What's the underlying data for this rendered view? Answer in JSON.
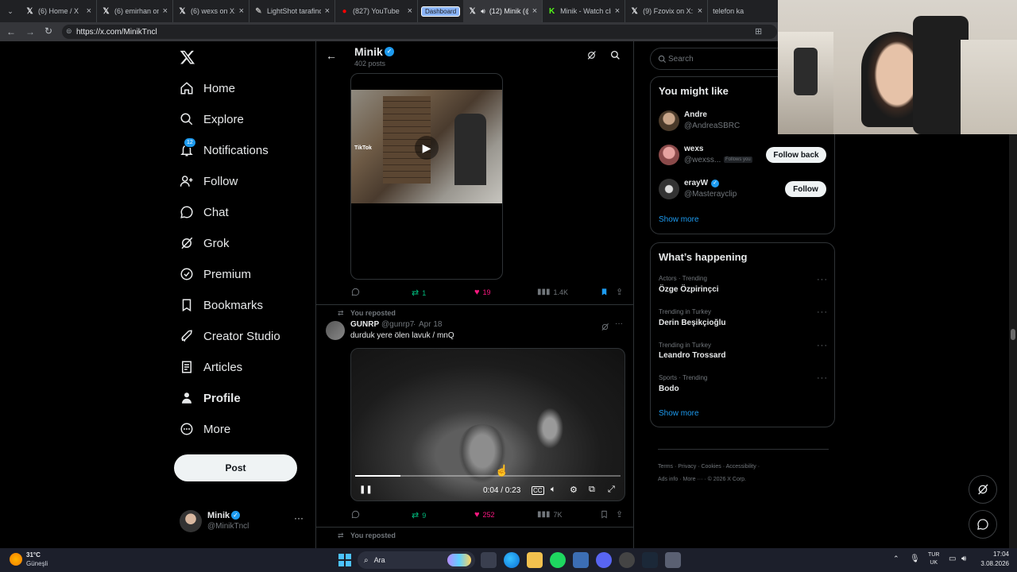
{
  "browser": {
    "tabs": [
      {
        "title": "(6) Home / X",
        "icon": "x-icon"
      },
      {
        "title": "(6) emirhan on X: '",
        "icon": "x-icon"
      },
      {
        "title": "(6) wexs on X: \"eski",
        "icon": "x-icon"
      },
      {
        "title": "LightShot tarafinda",
        "icon": "pen-icon"
      },
      {
        "title": "(827) YouTube",
        "icon": "youtube-icon"
      },
      {
        "title": "(12) Minik (@",
        "icon": "x-icon"
      },
      {
        "title": "Minik - Watch clip",
        "icon": "kick-icon"
      },
      {
        "title": "(9) Fzovix on X: \"E",
        "icon": "x-icon"
      },
      {
        "title": "telefon ka",
        "icon": "x-icon"
      }
    ],
    "group_label": "Dashboard",
    "url": "https://x.com/MinikTncl"
  },
  "sidebar": {
    "items": [
      {
        "label": "Home",
        "icon": "home-icon"
      },
      {
        "label": "Explore",
        "icon": "search-icon"
      },
      {
        "label": "Notifications",
        "icon": "bell-icon",
        "badge": "12"
      },
      {
        "label": "Follow",
        "icon": "person-plus-icon"
      },
      {
        "label": "Chat",
        "icon": "chat-icon"
      },
      {
        "label": "Grok",
        "icon": "grok-icon"
      },
      {
        "label": "Premium",
        "icon": "verified-icon"
      },
      {
        "label": "Bookmarks",
        "icon": "bookmark-icon"
      },
      {
        "label": "Creator Studio",
        "icon": "rocket-icon"
      },
      {
        "label": "Articles",
        "icon": "article-icon"
      },
      {
        "label": "Profile",
        "icon": "person-icon"
      },
      {
        "label": "More",
        "icon": "more-circle-icon"
      }
    ],
    "post_button": "Post",
    "account": {
      "name": "Minik",
      "handle": "@MinikTncl"
    }
  },
  "profile_header": {
    "name": "Minik",
    "posts": "402 posts"
  },
  "tweet1": {
    "video_watermark": "TikTok",
    "stats": {
      "replies": "",
      "reposts": "1",
      "likes": "19",
      "views": "1.4K"
    }
  },
  "tweet2": {
    "reposted_label": "You reposted",
    "author": "GUNRP",
    "handle": "@gunrp7",
    "date": "Apr 18",
    "text": "durduk yere ölen lavuk / mnQ",
    "video_time": "0:04 / 0:23",
    "video_progress": 0.17,
    "stats": {
      "replies": "",
      "reposts": "9",
      "likes": "252",
      "views": "7K"
    }
  },
  "tweet3": {
    "reposted_label": "You reposted"
  },
  "search": {
    "placeholder": "Search"
  },
  "you_might_like": {
    "title": "You might like",
    "users": [
      {
        "name": "Andre",
        "handle": "@AndreaSBRC",
        "button": ""
      },
      {
        "name": "wexs",
        "handle": "@wexss...",
        "badge": "Follows you",
        "button": "Follow back"
      },
      {
        "name": "erayW",
        "handle": "@Masterayclip",
        "button": "Follow",
        "verified": true
      }
    ],
    "show_more": "Show more"
  },
  "whats_happening": {
    "title": "What’s happening",
    "trends": [
      {
        "category": "Actors · Trending",
        "name": "Özge Özpirinçci"
      },
      {
        "category": "Trending in Turkey",
        "name": "Derin Beşikçioğlu"
      },
      {
        "category": "Trending in Turkey",
        "name": "Leandro Trossard"
      },
      {
        "category": "Sports · Trending",
        "name": "Bodo"
      }
    ],
    "show_more": "Show more"
  },
  "footer": {
    "links": [
      "Terms",
      "Privacy",
      "Cookies",
      "Accessibility",
      "Ads info",
      "More ···"
    ],
    "copyright": "© 2026 X Corp."
  },
  "taskbar": {
    "weather_temp": "31°C",
    "weather_label": "Güneşli",
    "search_label": "Ara",
    "lang_top": "TUR",
    "lang_bottom": "UK",
    "time": "17:04",
    "date": "3.08.2026"
  },
  "colors": {
    "accent": "#1d9bf0",
    "repost_green": "#00ba7c",
    "like_pink": "#f91880",
    "border": "#2f3336",
    "muted": "#71767b"
  }
}
